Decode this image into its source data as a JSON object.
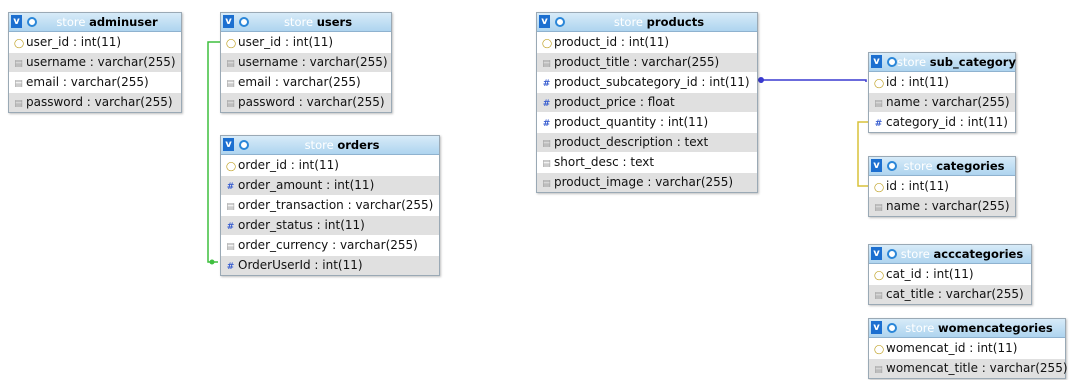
{
  "tables": {
    "adminuser": {
      "db": "store",
      "name": "adminuser",
      "rows": [
        {
          "label": "user_id : int(11)",
          "icon": "key-icon"
        },
        {
          "label": "username : varchar(255)",
          "icon": "text-field-icon"
        },
        {
          "label": "email : varchar(255)",
          "icon": "text-field-icon"
        },
        {
          "label": "password : varchar(255)",
          "icon": "text-field-icon"
        }
      ]
    },
    "users": {
      "db": "store",
      "name": "users",
      "rows": [
        {
          "label": "user_id : int(11)",
          "icon": "key-icon"
        },
        {
          "label": "username : varchar(255)",
          "icon": "text-field-icon"
        },
        {
          "label": "email : varchar(255)",
          "icon": "text-field-icon"
        },
        {
          "label": "password : varchar(255)",
          "icon": "text-field-icon"
        }
      ]
    },
    "orders": {
      "db": "store",
      "name": "orders",
      "rows": [
        {
          "label": "order_id : int(11)",
          "icon": "key-icon"
        },
        {
          "label": "order_amount : int(11)",
          "icon": "number-field-icon"
        },
        {
          "label": "order_transaction : varchar(255)",
          "icon": "text-field-icon"
        },
        {
          "label": "order_status : int(11)",
          "icon": "number-field-icon"
        },
        {
          "label": "order_currency : varchar(255)",
          "icon": "text-field-icon"
        },
        {
          "label": "OrderUserId : int(11)",
          "icon": "number-field-icon"
        }
      ]
    },
    "products": {
      "db": "store",
      "name": "products",
      "rows": [
        {
          "label": "product_id : int(11)",
          "icon": "key-icon"
        },
        {
          "label": "product_title : varchar(255)",
          "icon": "text-field-icon"
        },
        {
          "label": "product_subcategory_id : int(11)",
          "icon": "number-field-icon"
        },
        {
          "label": "product_price : float",
          "icon": "number-field-icon"
        },
        {
          "label": "product_quantity : int(11)",
          "icon": "number-field-icon"
        },
        {
          "label": "product_description : text",
          "icon": "text-field-icon"
        },
        {
          "label": "short_desc : text",
          "icon": "text-field-icon"
        },
        {
          "label": "product_image : varchar(255)",
          "icon": "text-field-icon"
        }
      ]
    },
    "sub_category": {
      "db": "store",
      "name": "sub_category",
      "rows": [
        {
          "label": "id : int(11)",
          "icon": "key-icon"
        },
        {
          "label": "name : varchar(255)",
          "icon": "text-field-icon"
        },
        {
          "label": "category_id : int(11)",
          "icon": "number-field-icon"
        }
      ]
    },
    "categories": {
      "db": "store",
      "name": "categories",
      "rows": [
        {
          "label": "id : int(11)",
          "icon": "key-icon"
        },
        {
          "label": "name : varchar(255)",
          "icon": "text-field-icon"
        }
      ]
    },
    "acccategories": {
      "db": "store",
      "name": "acccategories",
      "rows": [
        {
          "label": "cat_id : int(11)",
          "icon": "key-icon"
        },
        {
          "label": "cat_title : varchar(255)",
          "icon": "text-field-icon"
        }
      ]
    },
    "womencategories": {
      "db": "store",
      "name": "womencategories",
      "rows": [
        {
          "label": "womencat_id : int(11)",
          "icon": "key-icon"
        },
        {
          "label": "womencat_title : varchar(255)",
          "icon": "text-field-icon"
        }
      ]
    }
  },
  "relations": [
    {
      "from": "orders.OrderUserId",
      "to": "users.user_id",
      "color": "#3fbf3f"
    },
    {
      "from": "products.product_subcategory_id",
      "to": "sub_category.id",
      "color": "#3a3ad0"
    },
    {
      "from": "sub_category.category_id",
      "to": "categories.id",
      "color": "#d8c23a"
    }
  ],
  "header_glyph": "v"
}
